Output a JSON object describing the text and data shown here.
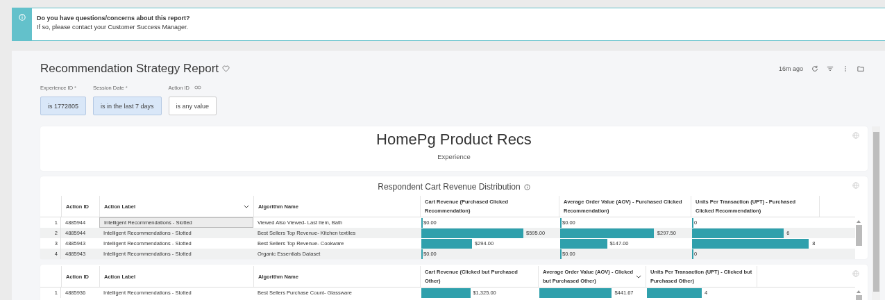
{
  "banner": {
    "title": "Do you have questions/concerns about this report?",
    "message": "If so, please contact your Customer Success Manager."
  },
  "report": {
    "title": "Recommendation Strategy Report",
    "updated": "16m ago"
  },
  "filters": [
    {
      "kind": "required",
      "label": "Experience ID",
      "required_mark": "*",
      "value": "is 1772805",
      "active": true
    },
    {
      "kind": "required",
      "label": "Session Date",
      "required_mark": "*",
      "value": "is in the last 7 days",
      "active": true
    },
    {
      "kind": "linked",
      "label": "Action ID",
      "value": "is any value",
      "active": false
    }
  ],
  "header_card": {
    "title": "HomePg Product Recs",
    "subtitle": "Experience"
  },
  "tables": [
    {
      "title": "Respondent Cart Revenue Distribution",
      "columns": [
        {
          "label": "Action ID",
          "kind": "text",
          "sorted": false
        },
        {
          "label": "Action Label",
          "kind": "text",
          "sorted": true
        },
        {
          "label": "Algorithm Name",
          "kind": "text",
          "sorted": false
        },
        {
          "label": "Cart Revenue (Purchased Clicked Recommendation)",
          "kind": "bar",
          "sorted": false
        },
        {
          "label": "Average Order Value (AOV) - Purchased Clicked Recommendation)",
          "kind": "bar",
          "sorted": false
        },
        {
          "label": "Units Per Transaction (UPT) - Purchased Clicked Recommendation)",
          "kind": "bar",
          "sorted": false
        }
      ],
      "rows": [
        {
          "index": "1",
          "selected": true,
          "cells": [
            {
              "text": "4885944"
            },
            {
              "text": "Intelligent Recommendations - Slotted"
            },
            {
              "text": "Viewed Also Viewed- Last Item, Bath"
            },
            {
              "text": "$0.00",
              "level": 0
            },
            {
              "text": "$0.00",
              "level": 0
            },
            {
              "text": "0",
              "level": 0
            }
          ]
        },
        {
          "index": "2",
          "selected": false,
          "cells": [
            {
              "text": "4885944"
            },
            {
              "text": "Intelligent Recommendations - Slotted"
            },
            {
              "text": "Best Sellers Top Revenue- Kitchen textiles"
            },
            {
              "text": "$595.00",
              "level": 0.74
            },
            {
              "text": "$297.50",
              "level": 0.72
            },
            {
              "text": "6",
              "level": 0.72
            }
          ]
        },
        {
          "index": "3",
          "selected": false,
          "cells": [
            {
              "text": "4885943"
            },
            {
              "text": "Intelligent Recommendations - Slotted"
            },
            {
              "text": "Best Sellers Top Revenue- Cookware"
            },
            {
              "text": "$294.00",
              "level": 0.37
            },
            {
              "text": "$147.00",
              "level": 0.36
            },
            {
              "text": "8",
              "level": 0.92
            }
          ]
        },
        {
          "index": "4",
          "selected": false,
          "cells": [
            {
              "text": "4885943"
            },
            {
              "text": "Intelligent Recommendations - Slotted"
            },
            {
              "text": "Organic Essentials Dataset"
            },
            {
              "text": "$0.00",
              "level": 0
            },
            {
              "text": "$0.00",
              "level": 0
            },
            {
              "text": "0",
              "level": 0
            }
          ]
        }
      ]
    },
    {
      "columns": [
        {
          "label": "Action ID",
          "kind": "text",
          "sorted": false
        },
        {
          "label": "Action Label",
          "kind": "text",
          "sorted": false
        },
        {
          "label": "Algorithm Name",
          "kind": "text",
          "sorted": false
        },
        {
          "label": "Cart Revenue (Clicked but Purchased Other)",
          "kind": "bar",
          "sorted": false
        },
        {
          "label": "Average Order Value (AOV) - Clicked but Purchased Other)",
          "kind": "bar",
          "sorted": true
        },
        {
          "label": "Units Per Transaction (UPT) - Clicked but Purchased Other)",
          "kind": "bar",
          "sorted": false
        }
      ],
      "rows": [
        {
          "index": "1",
          "selected": false,
          "cells": [
            {
              "text": "4885936"
            },
            {
              "text": "Intelligent Recommendations - Slotted"
            },
            {
              "text": "Best Sellers Purchase Count- Glassware"
            },
            {
              "text": "$1,325.00",
              "level": 0.42
            },
            {
              "text": "$441.67",
              "level": 0.68
            },
            {
              "text": "4",
              "level": 0.5
            }
          ]
        }
      ]
    }
  ]
}
